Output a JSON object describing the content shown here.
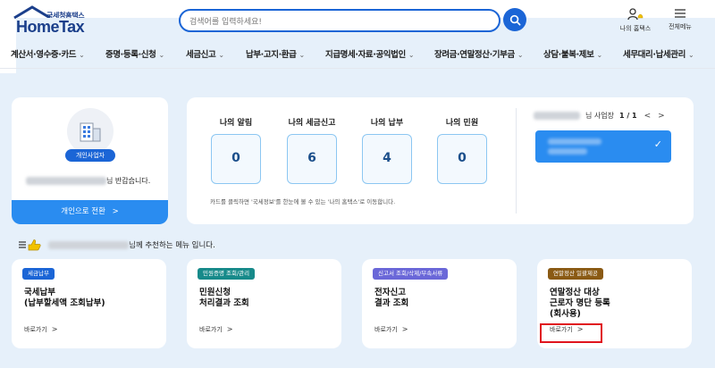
{
  "logo": {
    "sub": "국세청홈택스",
    "main": "HomeTax"
  },
  "search": {
    "placeholder": "검색어를 입력하세요!"
  },
  "util": [
    {
      "label": "나의 홈택스",
      "icon": "user-bell-icon"
    },
    {
      "label": "전체메뉴",
      "icon": "hamburger-menu-icon"
    }
  ],
  "nav": [
    "계산서·영수증·카드",
    "증명·등록·신청",
    "세금신고",
    "납부·고지·환급",
    "지급명세·자료·공익법인",
    "장려금·연말정산·기부금",
    "상담·불복·제보",
    "세무대리·납세관리"
  ],
  "profile": {
    "badge": "개인사업자",
    "greeting_suffix": "님 반갑습니다.",
    "switch_label": "개인으로 전환",
    "switch_arrow": ">"
  },
  "stats": [
    {
      "label": "나의 알림",
      "value": "0"
    },
    {
      "label": "나의 세금신고",
      "value": "6"
    },
    {
      "label": "나의 납부",
      "value": "4"
    },
    {
      "label": "나의 민원",
      "value": "0"
    }
  ],
  "stats_note": "카드를 클릭하면 '국세정보'를 한눈에 볼 수 있는 '나의 홈택스'로 이동합니다.",
  "business": {
    "suffix": "님 사업장",
    "pager": "1 / 1",
    "prev": "<",
    "next": ">",
    "check": "✓"
  },
  "recommend_suffix": "님께 추천하는 메뉴 입니다.",
  "menus": [
    {
      "tag": "세금납부",
      "tag_color": "#1b65d6",
      "title": "국세납부\n(납부할세액 조회납부)",
      "link": "바로가기",
      "arrow": ">"
    },
    {
      "tag": "민원증명 조회/관리",
      "tag_color": "#178a8a",
      "title": "민원신청\n처리결과 조회",
      "link": "바로가기",
      "arrow": ">"
    },
    {
      "tag": "신고서 조회/삭제/부속서류",
      "tag_color": "#6a67d8",
      "title": "전자신고\n결과 조회",
      "link": "바로가기",
      "arrow": ">"
    },
    {
      "tag": "연말정산 일괄제공",
      "tag_color": "#8a5a14",
      "title": "연말정산 대상\n근로자 명단 등록\n(회사용)",
      "link": "바로가기",
      "arrow": ">"
    }
  ],
  "colors": {
    "primary": "#1b65d6",
    "accent": "#2a8cf0",
    "highlight": "#e0141e",
    "background": "#e6f0fa"
  }
}
